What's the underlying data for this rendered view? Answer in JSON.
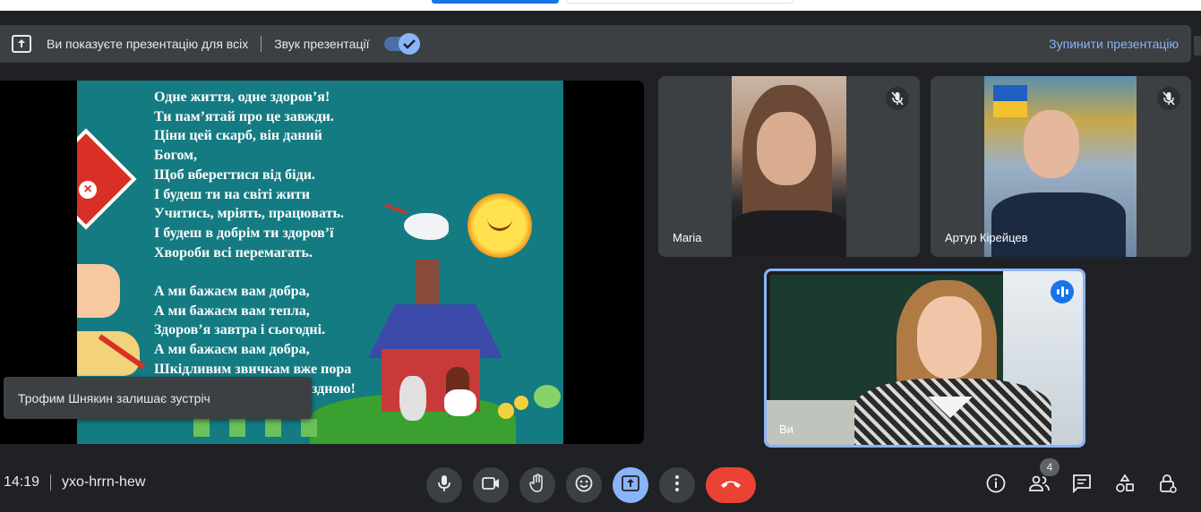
{
  "presentation_bar": {
    "status_text": "Ви показуєте презентацію для всіх",
    "audio_label": "Звук презентації",
    "audio_enabled": true,
    "stop_label": "Зупинити презентацію"
  },
  "slide": {
    "poem_lines": [
      "Одне життя, одне здоров’я!",
      "Ти пам’ятай про це завжди.",
      "Ціни цей скарб, він даний",
      "Богом,",
      "Щоб вберегтися від біди.",
      "І будеш ти на світі жити",
      "Учитись, мріять, працювать.",
      "І будеш в добрім ти здоров’ї",
      "Хвороби всі перемагать.",
      "",
      "А ми бажаєм вам добра,",
      "А ми бажаєм вам тепла,",
      "Здоров’я завтра і сьогодні.",
      "А ми бажаєм вам добра,",
      "Шкідливим звичкам вже пора",
      "здною!"
    ]
  },
  "toast": {
    "text": "Трофим Шнякин залишає зустріч"
  },
  "participants": [
    {
      "name": "Maria",
      "muted": true
    },
    {
      "name": "Артур Кірейцев",
      "muted": true
    },
    {
      "name": "Ви",
      "speaking": true
    }
  ],
  "meeting": {
    "time": "14:19",
    "code": "yxo-hrrn-hew",
    "participant_count": "4"
  },
  "colors": {
    "background": "#202124",
    "surface": "#3c4043",
    "accent": "#8ab4f8",
    "hangup": "#ea4335",
    "slide_bg": "#147b82"
  },
  "icons": {
    "present": "present-to-all-icon",
    "mic": "mic-icon",
    "camera": "videocam-icon",
    "hand": "raise-hand-icon",
    "emoji": "emoji-icon",
    "more": "more-vert-icon",
    "hangup": "call-end-icon",
    "info": "info-icon",
    "people": "people-icon",
    "chat": "chat-icon",
    "activities": "activities-icon",
    "host": "host-controls-icon"
  }
}
